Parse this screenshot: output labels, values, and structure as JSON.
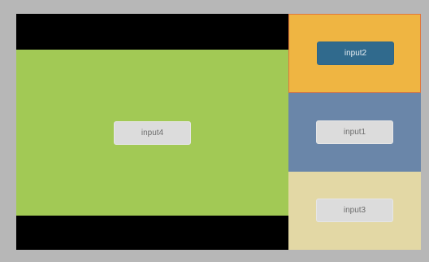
{
  "layout": {
    "main": {
      "label": "input4",
      "color": "#a2c955"
    },
    "side": [
      {
        "label": "input2",
        "color": "#efb542",
        "border_color": "#e2773a",
        "button_color": "#306a8d",
        "selected": true
      },
      {
        "label": "input1",
        "color": "#6a86a9",
        "selected": false
      },
      {
        "label": "input3",
        "color": "#e3d8a5",
        "selected": false
      }
    ]
  },
  "colors": {
    "background": "#b7b7b7",
    "letterbox": "#000000",
    "button_default": "#dcdcdc"
  }
}
